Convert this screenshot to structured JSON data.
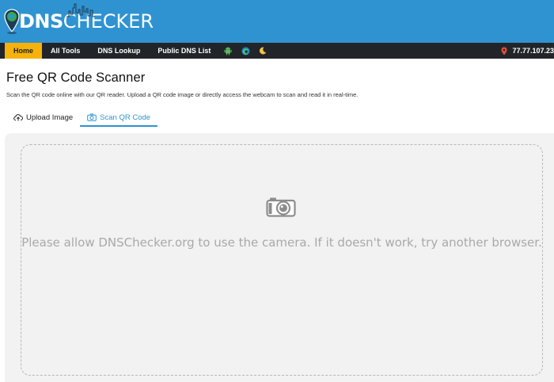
{
  "brand": {
    "logo_dns": "DNS",
    "logo_checker": "CHECKER",
    "colors": {
      "header_bg": "#2f93d1",
      "navbar_bg": "#212529",
      "accent": "#f5b20b",
      "tab_active": "#2f93d1"
    }
  },
  "navbar": {
    "items": [
      {
        "label": "Home",
        "active": true
      },
      {
        "label": "All Tools"
      },
      {
        "label": "DNS Lookup"
      },
      {
        "label": "Public DNS List"
      }
    ],
    "icons": [
      "android-icon",
      "edge-icon",
      "moon-icon"
    ],
    "ip_address": "77.77.107.23"
  },
  "page": {
    "title": "Free QR Code Scanner",
    "subtitle": "Scan the QR code online with our QR reader. Upload a QR code image or directly access the webcam to scan and read it in real-time."
  },
  "tabs": [
    {
      "label": "Upload Image",
      "icon": "cloud-upload-icon",
      "active": false
    },
    {
      "label": "Scan QR Code",
      "icon": "camera-icon",
      "active": true
    }
  ],
  "scanner": {
    "camera_icon": "camera-icon",
    "message": "Please allow DNSChecker.org to use the camera. If it doesn't work, try another browser."
  }
}
